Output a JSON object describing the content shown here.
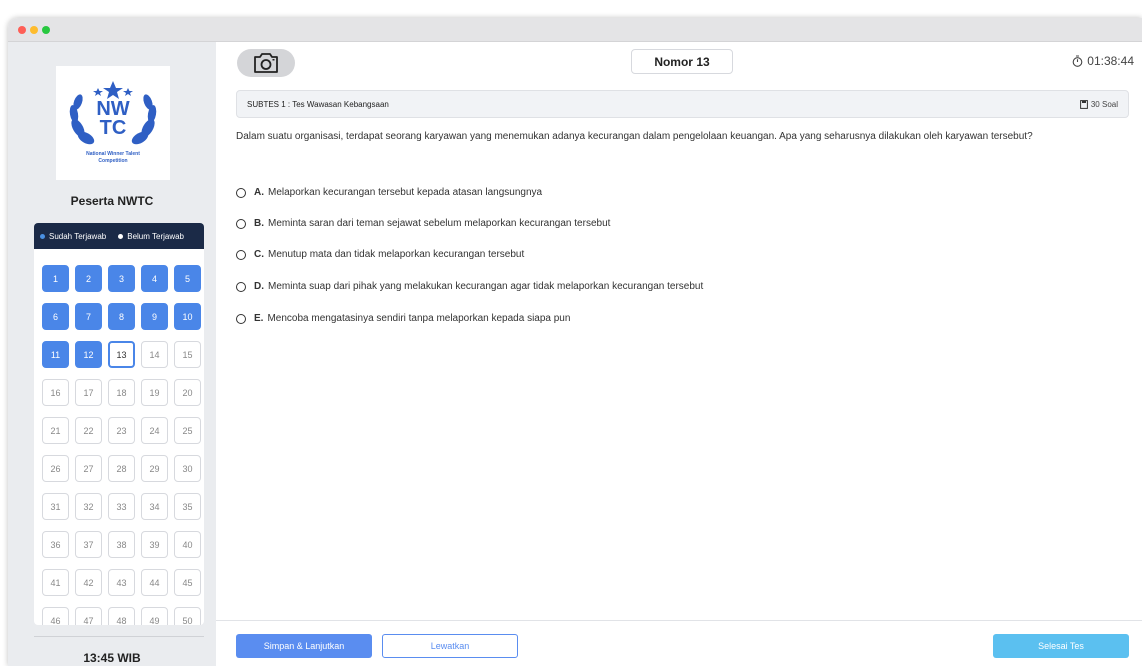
{
  "sidebar": {
    "logo": {
      "abbr_top": "NW",
      "abbr_bottom": "TC",
      "line1": "National Winner Talent",
      "line2": "Competition"
    },
    "participant": "Peserta NWTC",
    "legend": {
      "answered_label": "Sudah Terjawab",
      "unanswered_label": "Belum Terjawab"
    },
    "clock": "13:45 WIB"
  },
  "questions": {
    "answered": [
      1,
      2,
      3,
      4,
      5,
      6,
      7,
      8,
      9,
      10,
      11,
      12
    ],
    "current": 13,
    "numbers": [
      1,
      2,
      3,
      4,
      5,
      6,
      7,
      8,
      9,
      10,
      11,
      12,
      13,
      14,
      15,
      16,
      17,
      18,
      19,
      20,
      21,
      22,
      23,
      24,
      25,
      26,
      27,
      28,
      29,
      30,
      31,
      32,
      33,
      34,
      35,
      36,
      37,
      38,
      39,
      40,
      41,
      42,
      43,
      44,
      45,
      46,
      47,
      48,
      49,
      50
    ]
  },
  "header": {
    "camera_icon": "camera-icon",
    "nomor": "Nomor 13",
    "timer": "01:38:44"
  },
  "subtest": {
    "title": "SUBTES 1 : Tes Wawasan Kebangsaan",
    "count": "30 Soal"
  },
  "question": {
    "text": "Dalam suatu organisasi, terdapat seorang karyawan yang menemukan adanya kecurangan dalam pengelolaan keuangan. Apa yang seharusnya dilakukan oleh karyawan tersebut?",
    "options": [
      {
        "letter": "A.",
        "text": "Melaporkan kecurangan tersebut kepada atasan langsungnya"
      },
      {
        "letter": "B.",
        "text": "Meminta saran dari teman sejawat sebelum melaporkan kecurangan tersebut"
      },
      {
        "letter": "C.",
        "text": "Menutup mata dan tidak melaporkan kecurangan tersebut"
      },
      {
        "letter": "D.",
        "text": "Meminta suap dari pihak yang melakukan kecurangan agar tidak melaporkan kecurangan tersebut"
      },
      {
        "letter": "E.",
        "text": "Mencoba mengatasinya sendiri tanpa melaporkan kepada siapa pun"
      }
    ]
  },
  "footer": {
    "save_label": "Simpan & Lanjutkan",
    "skip_label": "Lewatkan",
    "finish_label": "Selesai Tes"
  }
}
